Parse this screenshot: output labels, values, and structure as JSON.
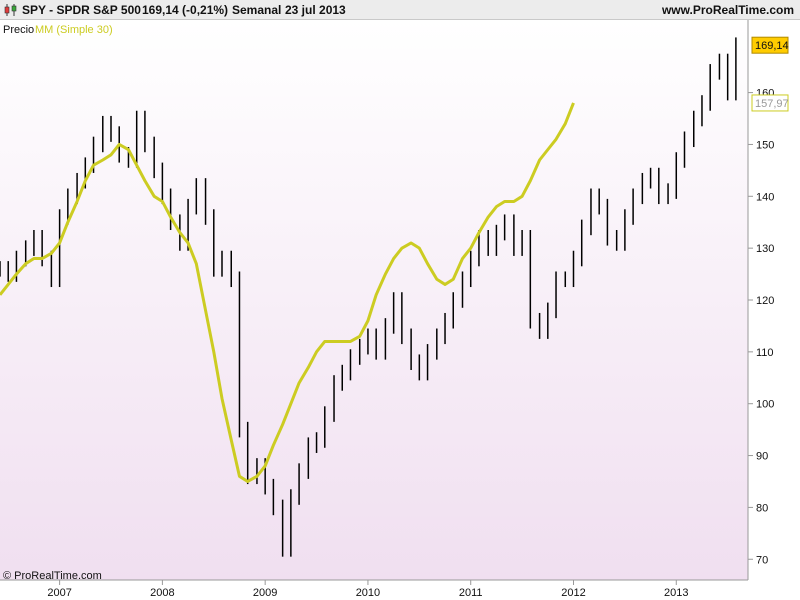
{
  "header": {
    "instrument": "SPY - SPDR S&P 500",
    "last_quote": "169,14 (-0,21%)",
    "period": "Semanal",
    "date": "23 jul 2013",
    "site": "www.ProRealTime.com"
  },
  "legend": {
    "price_label": "Precio",
    "ma_label": "MM (Simple 30)"
  },
  "copyright": "© ProRealTime.com",
  "colors": {
    "background_top": "#ffffff",
    "background_bottom": "#f0dff0",
    "price_bars": "#000000",
    "moving_average": "#cccc22",
    "last_price_tag": "#ffcc00",
    "ma_tag_border": "#cccc22"
  },
  "chart_data": {
    "type": "line",
    "title": "SPY - SPDR S&P 500",
    "x_range": [
      2006.42,
      2013.62
    ],
    "ylim": [
      66,
      174
    ],
    "y_ticks": [
      70,
      80,
      90,
      100,
      110,
      120,
      130,
      140,
      150,
      160
    ],
    "y_tick_labels": [
      "70",
      "80",
      "90",
      "100",
      "110",
      "120",
      "130",
      "140",
      "150",
      "160"
    ],
    "x_ticks": [
      2007,
      2008,
      2009,
      2010,
      2011,
      2012,
      2013
    ],
    "x_tick_labels": [
      "2007",
      "2008",
      "2009",
      "2010",
      "2011",
      "2012",
      "2013"
    ],
    "price_tag": "169,14",
    "ma_tag": "157,97",
    "series": [
      {
        "name": "Precio",
        "style": "weekly price bars",
        "points": [
          [
            2006.42,
            126
          ],
          [
            2006.5,
            125
          ],
          [
            2006.58,
            128
          ],
          [
            2006.67,
            130
          ],
          [
            2006.75,
            132
          ],
          [
            2006.83,
            128
          ],
          [
            2006.92,
            124
          ],
          [
            2007.0,
            136
          ],
          [
            2007.08,
            140
          ],
          [
            2007.17,
            143
          ],
          [
            2007.25,
            146
          ],
          [
            2007.33,
            150
          ],
          [
            2007.42,
            154
          ],
          [
            2007.5,
            152
          ],
          [
            2007.58,
            148
          ],
          [
            2007.67,
            147
          ],
          [
            2007.75,
            155
          ],
          [
            2007.83,
            150
          ],
          [
            2007.92,
            145
          ],
          [
            2008.0,
            140
          ],
          [
            2008.08,
            135
          ],
          [
            2008.17,
            131
          ],
          [
            2008.25,
            138
          ],
          [
            2008.33,
            142
          ],
          [
            2008.42,
            136
          ],
          [
            2008.5,
            126
          ],
          [
            2008.58,
            128
          ],
          [
            2008.67,
            124
          ],
          [
            2008.75,
            95
          ],
          [
            2008.83,
            86
          ],
          [
            2008.92,
            88
          ],
          [
            2009.0,
            84
          ],
          [
            2009.08,
            80
          ],
          [
            2009.17,
            72
          ],
          [
            2009.25,
            82
          ],
          [
            2009.33,
            87
          ],
          [
            2009.42,
            92
          ],
          [
            2009.5,
            93
          ],
          [
            2009.58,
            98
          ],
          [
            2009.67,
            104
          ],
          [
            2009.75,
            106
          ],
          [
            2009.83,
            109
          ],
          [
            2009.92,
            111
          ],
          [
            2010.0,
            113
          ],
          [
            2010.08,
            110
          ],
          [
            2010.17,
            115
          ],
          [
            2010.25,
            120
          ],
          [
            2010.33,
            113
          ],
          [
            2010.42,
            108
          ],
          [
            2010.5,
            106
          ],
          [
            2010.58,
            110
          ],
          [
            2010.67,
            113
          ],
          [
            2010.75,
            116
          ],
          [
            2010.83,
            120
          ],
          [
            2010.92,
            124
          ],
          [
            2011.0,
            128
          ],
          [
            2011.08,
            132
          ],
          [
            2011.17,
            130
          ],
          [
            2011.25,
            133
          ],
          [
            2011.33,
            135
          ],
          [
            2011.42,
            130
          ],
          [
            2011.5,
            132
          ],
          [
            2011.58,
            116
          ],
          [
            2011.67,
            114
          ],
          [
            2011.75,
            118
          ],
          [
            2011.83,
            124
          ],
          [
            2011.92,
            124
          ],
          [
            2012.0,
            128
          ],
          [
            2012.08,
            134
          ],
          [
            2012.17,
            140
          ],
          [
            2012.25,
            138
          ],
          [
            2012.33,
            132
          ],
          [
            2012.42,
            131
          ],
          [
            2012.5,
            136
          ],
          [
            2012.58,
            140
          ],
          [
            2012.67,
            143
          ],
          [
            2012.75,
            144
          ],
          [
            2012.83,
            140
          ],
          [
            2012.92,
            141
          ],
          [
            2013.0,
            147
          ],
          [
            2013.08,
            151
          ],
          [
            2013.17,
            155
          ],
          [
            2013.25,
            158
          ],
          [
            2013.33,
            164
          ],
          [
            2013.42,
            166
          ],
          [
            2013.5,
            160
          ],
          [
            2013.58,
            169.14
          ]
        ]
      },
      {
        "name": "MM (Simple 30)",
        "points": [
          [
            2006.42,
            121
          ],
          [
            2006.5,
            123
          ],
          [
            2006.58,
            125
          ],
          [
            2006.67,
            127
          ],
          [
            2006.75,
            128
          ],
          [
            2006.83,
            128
          ],
          [
            2006.92,
            129
          ],
          [
            2007.0,
            131
          ],
          [
            2007.08,
            135
          ],
          [
            2007.17,
            139
          ],
          [
            2007.25,
            143
          ],
          [
            2007.33,
            146
          ],
          [
            2007.42,
            147
          ],
          [
            2007.5,
            148
          ],
          [
            2007.58,
            150
          ],
          [
            2007.67,
            149
          ],
          [
            2007.75,
            146
          ],
          [
            2007.83,
            143
          ],
          [
            2007.92,
            140
          ],
          [
            2008.0,
            139
          ],
          [
            2008.08,
            136
          ],
          [
            2008.17,
            133
          ],
          [
            2008.25,
            131
          ],
          [
            2008.33,
            127
          ],
          [
            2008.42,
            118
          ],
          [
            2008.5,
            110
          ],
          [
            2008.58,
            101
          ],
          [
            2008.67,
            93
          ],
          [
            2008.75,
            86
          ],
          [
            2008.83,
            85
          ],
          [
            2008.92,
            86
          ],
          [
            2009.0,
            88
          ],
          [
            2009.08,
            92
          ],
          [
            2009.17,
            96
          ],
          [
            2009.25,
            100
          ],
          [
            2009.33,
            104
          ],
          [
            2009.42,
            107
          ],
          [
            2009.5,
            110
          ],
          [
            2009.58,
            112
          ],
          [
            2009.67,
            112
          ],
          [
            2009.75,
            112
          ],
          [
            2009.83,
            112
          ],
          [
            2009.92,
            113
          ],
          [
            2010.0,
            116
          ],
          [
            2010.08,
            121
          ],
          [
            2010.17,
            125
          ],
          [
            2010.25,
            128
          ],
          [
            2010.33,
            130
          ],
          [
            2010.42,
            131
          ],
          [
            2010.5,
            130
          ],
          [
            2010.58,
            127
          ],
          [
            2010.67,
            124
          ],
          [
            2010.75,
            123
          ],
          [
            2010.83,
            124
          ],
          [
            2010.92,
            128
          ],
          [
            2011.0,
            130
          ],
          [
            2011.08,
            133
          ],
          [
            2011.17,
            136
          ],
          [
            2011.25,
            138
          ],
          [
            2011.33,
            139
          ],
          [
            2011.42,
            139
          ],
          [
            2011.5,
            140
          ],
          [
            2011.58,
            143
          ],
          [
            2011.67,
            147
          ],
          [
            2011.75,
            149
          ],
          [
            2011.83,
            151
          ],
          [
            2011.92,
            154
          ],
          [
            2012.0,
            158
          ]
        ]
      }
    ]
  }
}
